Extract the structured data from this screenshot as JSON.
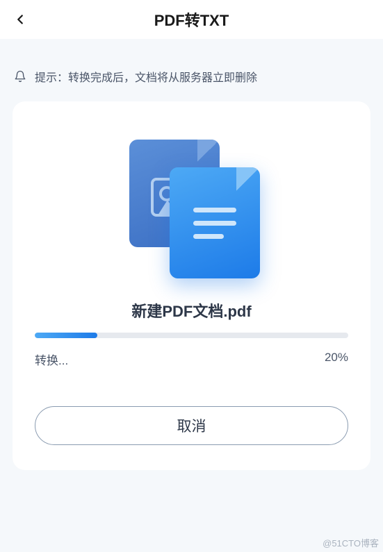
{
  "header": {
    "title": "PDF转TXT"
  },
  "notice": {
    "text": "提示：转换完成后，文档将从服务器立即删除"
  },
  "conversion": {
    "file_name": "新建PDF文档.pdf",
    "status_label": "转换...",
    "progress_percent": 20,
    "progress_display": "20%",
    "cancel_label": "取消"
  },
  "colors": {
    "accent_start": "#4da9f5",
    "accent_end": "#1d7be8",
    "background": "#f5f8fb"
  },
  "watermark": "@51CTO博客"
}
